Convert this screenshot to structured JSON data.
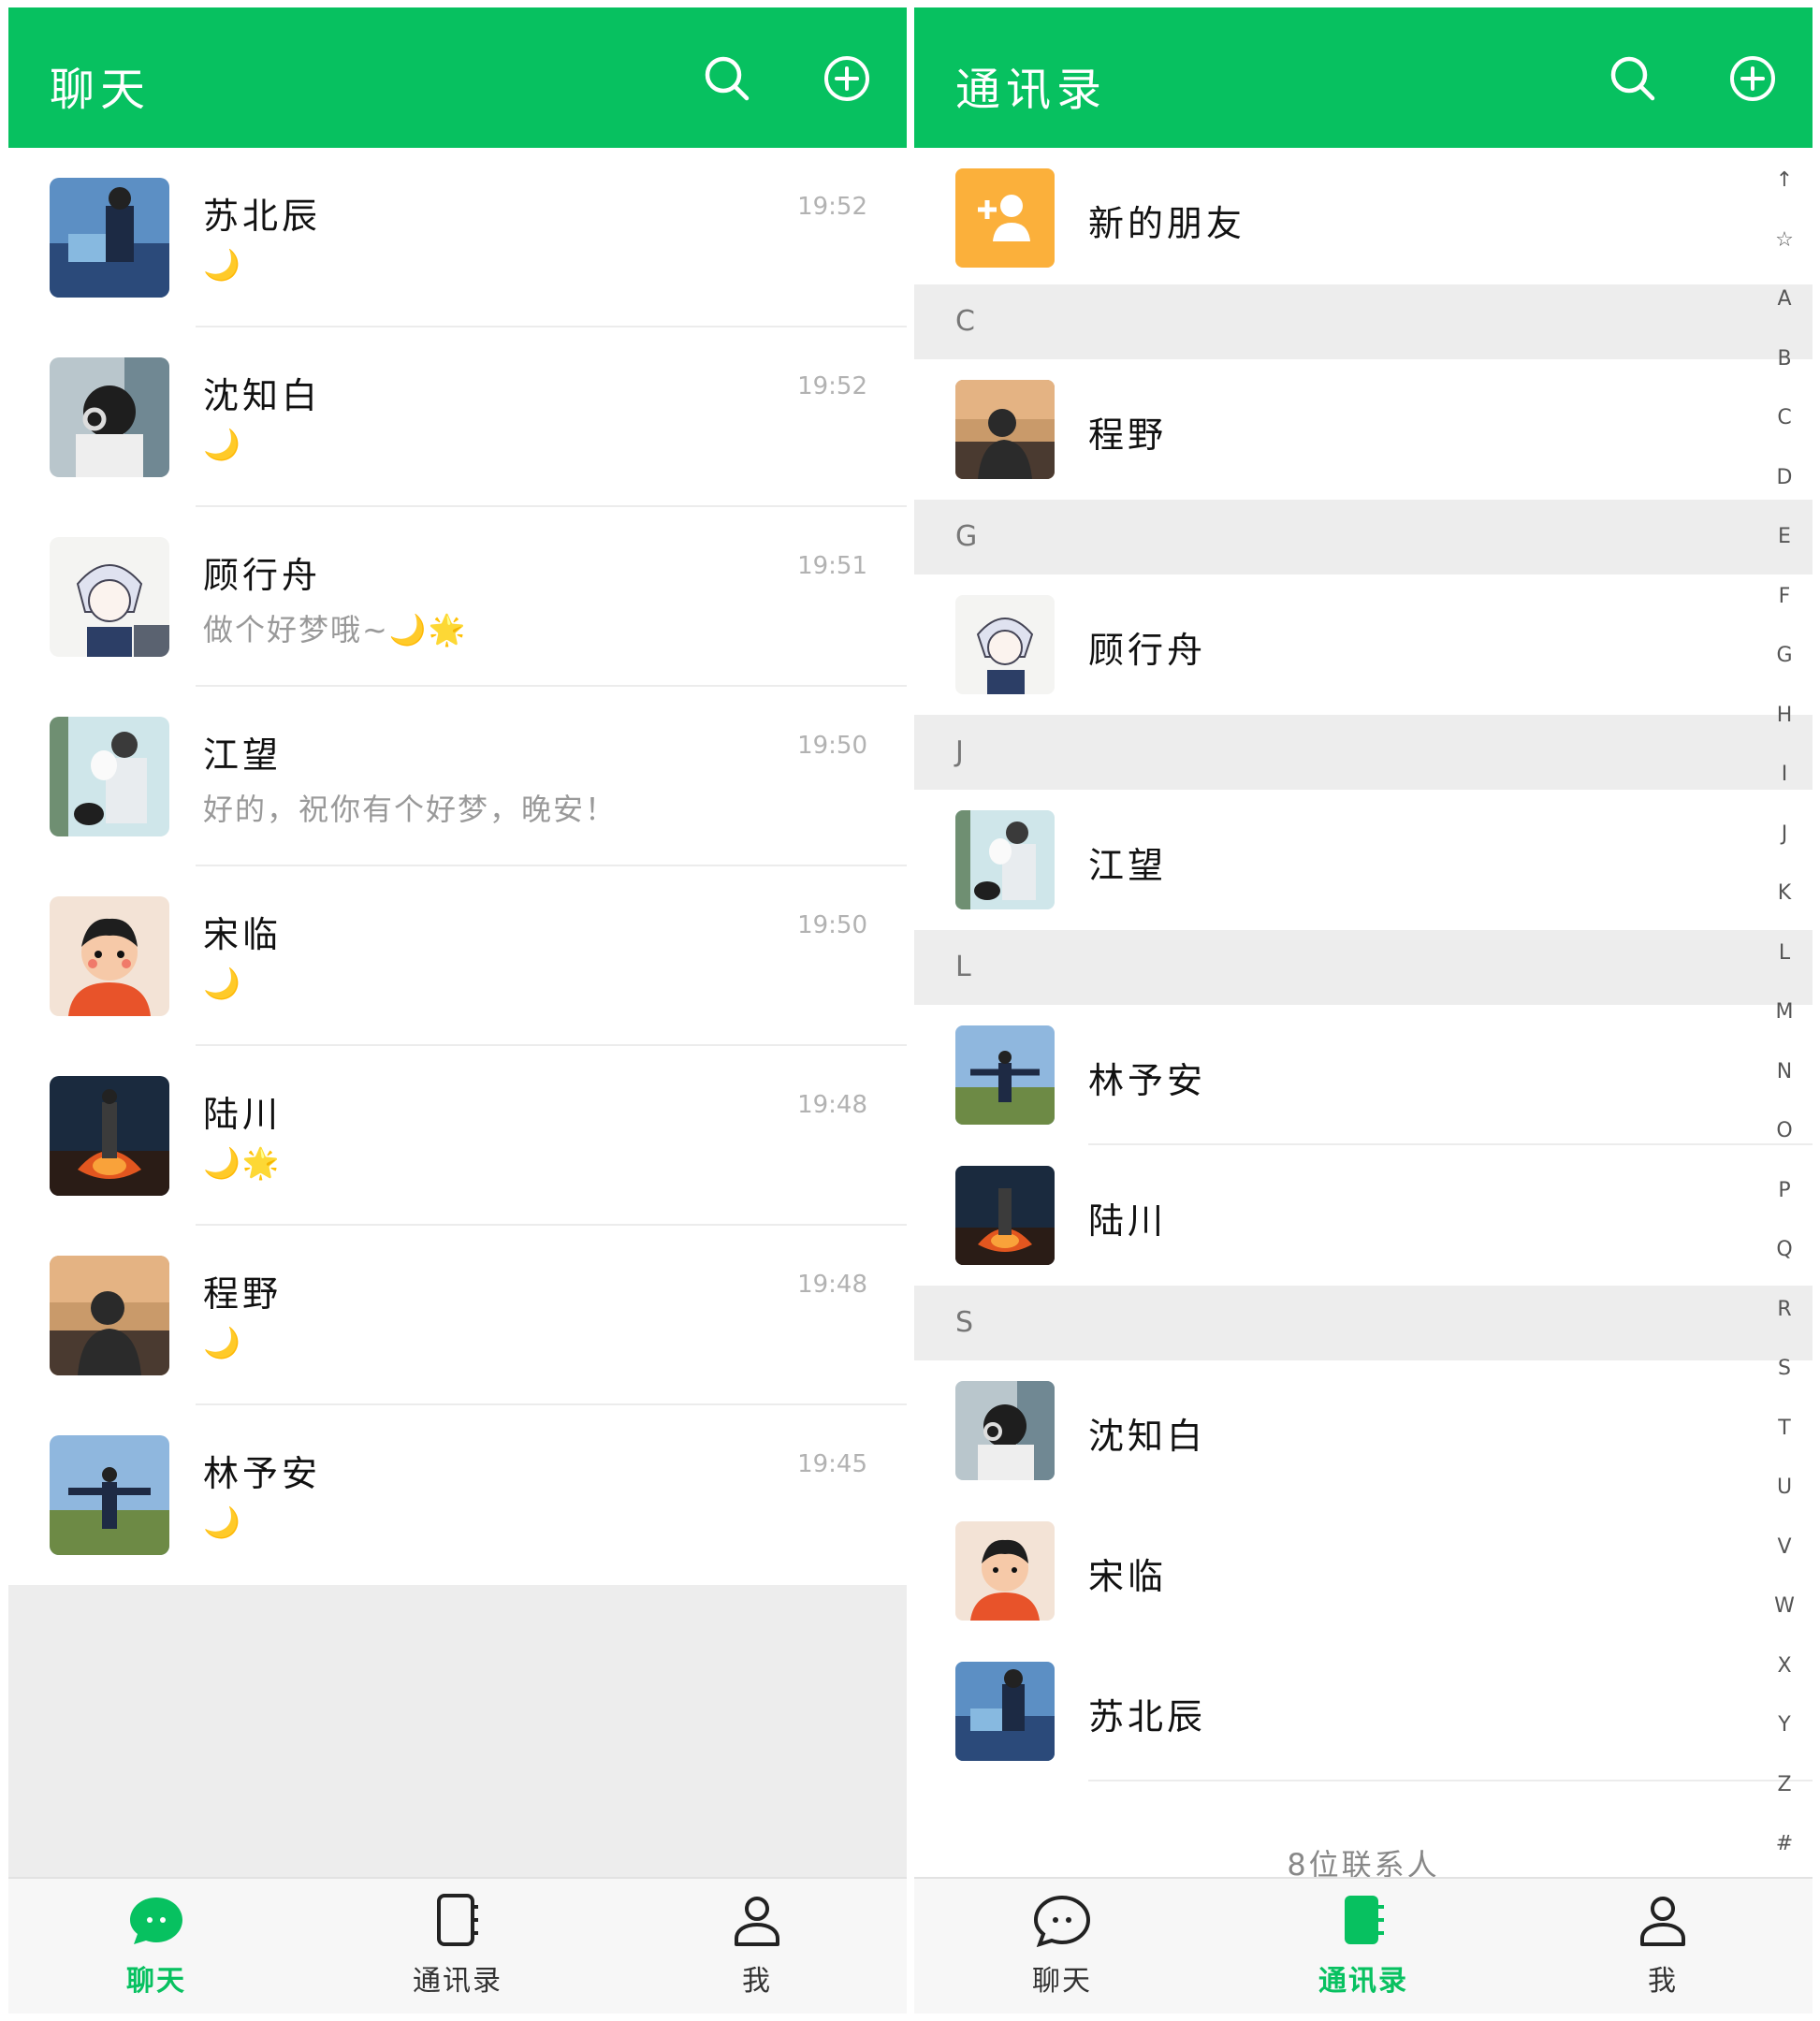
{
  "chat_panel": {
    "title": "聊天",
    "search_icon": "search-icon",
    "add_icon": "plus-circle-icon",
    "chats": [
      {
        "name": "苏北辰",
        "time": "19:52",
        "message": "🌙"
      },
      {
        "name": "沈知白",
        "time": "19:52",
        "message": "🌙"
      },
      {
        "name": "顾行舟",
        "time": "19:51",
        "message": "做个好梦哦~🌙🌟"
      },
      {
        "name": "江望",
        "time": "19:50",
        "message": "好的，祝你有个好梦，晚安！"
      },
      {
        "name": "宋临",
        "time": "19:50",
        "message": "🌙"
      },
      {
        "name": "陆川",
        "time": "19:48",
        "message": "🌙🌟"
      },
      {
        "name": "程野",
        "time": "19:48",
        "message": "🌙"
      },
      {
        "name": "林予安",
        "time": "19:45",
        "message": "🌙"
      }
    ],
    "tabs": {
      "chat": "聊天",
      "contacts": "通讯录",
      "me": "我"
    }
  },
  "contacts_panel": {
    "title": "通讯录",
    "new_friends": "新的朋友",
    "sections": [
      {
        "letter": "C",
        "contacts": [
          "程野"
        ]
      },
      {
        "letter": "G",
        "contacts": [
          "顾行舟"
        ]
      },
      {
        "letter": "J",
        "contacts": [
          "江望"
        ]
      },
      {
        "letter": "L",
        "contacts": [
          "林予安",
          "陆川"
        ]
      },
      {
        "letter": "S",
        "contacts": [
          "沈知白",
          "宋临",
          "苏北辰"
        ]
      }
    ],
    "footer": "8位联系人",
    "index": [
      "↑",
      "☆",
      "A",
      "B",
      "C",
      "D",
      "E",
      "F",
      "G",
      "H",
      "I",
      "J",
      "K",
      "L",
      "M",
      "N",
      "O",
      "P",
      "Q",
      "R",
      "S",
      "T",
      "U",
      "V",
      "W",
      "X",
      "Y",
      "Z",
      "#"
    ],
    "tabs": {
      "chat": "聊天",
      "contacts": "通讯录",
      "me": "我"
    }
  },
  "colors": {
    "accent": "#07c160",
    "new_friend_tile": "#fbb03b",
    "section_bg": "#ededed"
  }
}
